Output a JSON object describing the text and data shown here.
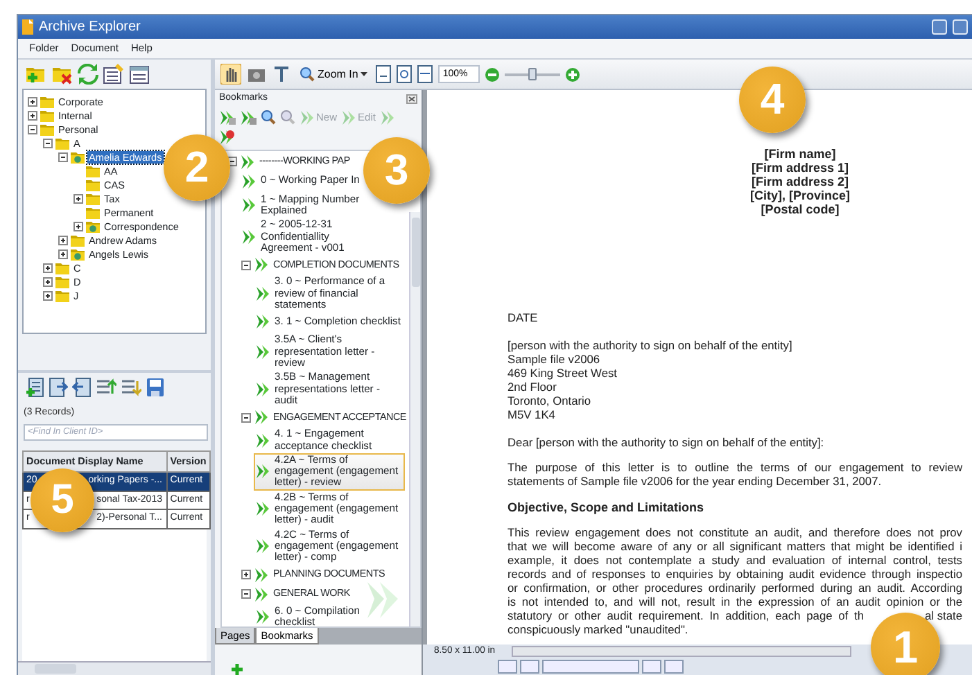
{
  "window": {
    "title": "Archive Explorer"
  },
  "menu": [
    "Folder",
    "Document",
    "Help"
  ],
  "folder_tree": [
    {
      "label": "Corporate",
      "kind": "folder",
      "expanded": false,
      "selected": false
    },
    {
      "label": "Internal",
      "kind": "folder",
      "expanded": false,
      "selected": false
    },
    {
      "label": "Personal",
      "kind": "folder",
      "expanded": true,
      "selected": false,
      "children": [
        {
          "label": "A",
          "kind": "folder",
          "expanded": true,
          "selected": false,
          "children": [
            {
              "label": "Amelia Edwards",
              "kind": "client",
              "expanded": true,
              "selected": true,
              "children": [
                {
                  "label": "AA",
                  "kind": "folder",
                  "selected": false
                },
                {
                  "label": "CAS",
                  "kind": "folder",
                  "selected": false
                },
                {
                  "label": "Tax",
                  "kind": "folder",
                  "expanded": false,
                  "selected": false
                },
                {
                  "label": "Permanent",
                  "kind": "folder",
                  "selected": false
                },
                {
                  "label": "Correspondence",
                  "kind": "client",
                  "expanded": false,
                  "selected": false
                }
              ]
            },
            {
              "label": "Andrew Adams",
              "kind": "folder",
              "expanded": false,
              "selected": false
            },
            {
              "label": "Angels Lewis",
              "kind": "client",
              "expanded": false,
              "selected": false
            }
          ]
        },
        {
          "label": "C",
          "kind": "folder",
          "expanded": false,
          "selected": false
        },
        {
          "label": "D",
          "kind": "folder",
          "expanded": false,
          "selected": false
        },
        {
          "label": "J",
          "kind": "folder",
          "expanded": false,
          "selected": false
        }
      ]
    }
  ],
  "records": {
    "count": "(3 Records)",
    "search": {
      "placeholder": "<Find In Client ID>"
    },
    "columns": [
      "Document Display Name",
      "Version"
    ],
    "rows": [
      {
        "name_start": "20",
        "name_end": "orking Papers -...",
        "version": "Current",
        "selected": true
      },
      {
        "name_start": "r",
        "name_end": "sonal Tax-2013",
        "version": "Current",
        "selected": false
      },
      {
        "name_start": "r",
        "name_end": "2)-Personal T...",
        "version": "Current",
        "selected": false
      }
    ]
  },
  "viewer_toolbar": {
    "zoom_button": "Zoom In",
    "zoom_field": "100%",
    "zoom_slider": {
      "level": 0.5
    }
  },
  "bookmarks": {
    "title": "Bookmarks",
    "tools": [
      "New",
      "Edit"
    ],
    "tree": [
      {
        "label": "--------WORKING PAP",
        "expanded": true,
        "selected": false,
        "children": [
          {
            "label": "0 ~ Working Paper In",
            "selected": false
          },
          {
            "label": "1 ~ Mapping Number Explained",
            "selected": false
          },
          {
            "label": "2 ~ 2005-12-31 Confidentiallity Agreement - v001",
            "selected": false
          },
          {
            "label": "COMPLETION DOCUMENTS",
            "expanded": true,
            "selected": false,
            "children": [
              {
                "label": "3. 0 ~ Performance of a review of financial statements",
                "selected": false
              },
              {
                "label": "3. 1 ~ Completion checklist",
                "selected": false
              },
              {
                "label": "3.5A ~ Client's representation letter - review",
                "selected": false
              },
              {
                "label": "3.5B ~ Management representations letter - audit",
                "selected": false
              }
            ]
          },
          {
            "label": "ENGAGEMENT ACCEPTANCE",
            "expanded": true,
            "selected": false,
            "children": [
              {
                "label": "4. 1 ~ Engagement acceptance checklist",
                "selected": false
              },
              {
                "label": "4.2A ~ Terms of engagement (engagement letter) - review",
                "selected": true
              },
              {
                "label": "4.2B ~ Terms of engagement (engagement letter) - audit",
                "selected": false
              },
              {
                "label": "4.2C ~ Terms of engagement (engagement letter) - comp",
                "selected": false
              }
            ]
          },
          {
            "label": "PLANNING DOCUMENTS",
            "expanded": false,
            "selected": false
          },
          {
            "label": "GENERAL WORK",
            "expanded": true,
            "selected": false,
            "children": [
              {
                "label": "6. 0 ~ Compilation checklist",
                "selected": false
              }
            ]
          }
        ]
      }
    ],
    "tabs": [
      {
        "label": "Pages",
        "selected": false
      },
      {
        "label": "Bookmarks",
        "selected": true
      }
    ]
  },
  "document": {
    "header": [
      "[Firm name]",
      "[Firm address 1]",
      "[Firm address 2]",
      "[City], [Province]",
      "[Postal code]"
    ],
    "date": "DATE",
    "address": [
      "[person with the authority to sign on behalf of the entity]",
      "Sample file v2006",
      "469 King Street West",
      "2nd Floor",
      "Toronto, Ontario",
      "M5V 1K4"
    ],
    "salutation": "Dear [person with the authority to sign on behalf of the entity]:",
    "paragraph_1": [
      {
        "text": "The purpose of this letter is to outline the terms of our engagement to review"
      },
      {
        "text": "statements of Sample file v2006 for the year ending December 31, 2007."
      }
    ],
    "heading": "Objective, Scope and Limitations",
    "paragraph_2": [
      {
        "text": "This review engagement does not constitute an audit, and therefore does not prov"
      },
      {
        "text": "that we will become aware of any or all significant matters that might be identified i"
      },
      {
        "text": "example, it does not contemplate a study and evaluation of internal control, tests"
      },
      {
        "text": "records and of responses to enquiries by obtaining audit evidence through inspectio"
      },
      {
        "text": "or confirmation, or other procedures ordinarily performed during an audit. According"
      },
      {
        "text": "is not intended to, and will not, result in the expression of an audit opinion or the"
      },
      {
        "text": "statutory or other audit requirement. In addition, each page of th",
        "end": "al state"
      },
      {
        "text": "conspicuously marked \"unaudited\"."
      }
    ]
  },
  "status": {
    "page_size": "8.50 x 11.00 in"
  },
  "callouts": [
    "4",
    "2",
    "3",
    "5",
    "1"
  ]
}
